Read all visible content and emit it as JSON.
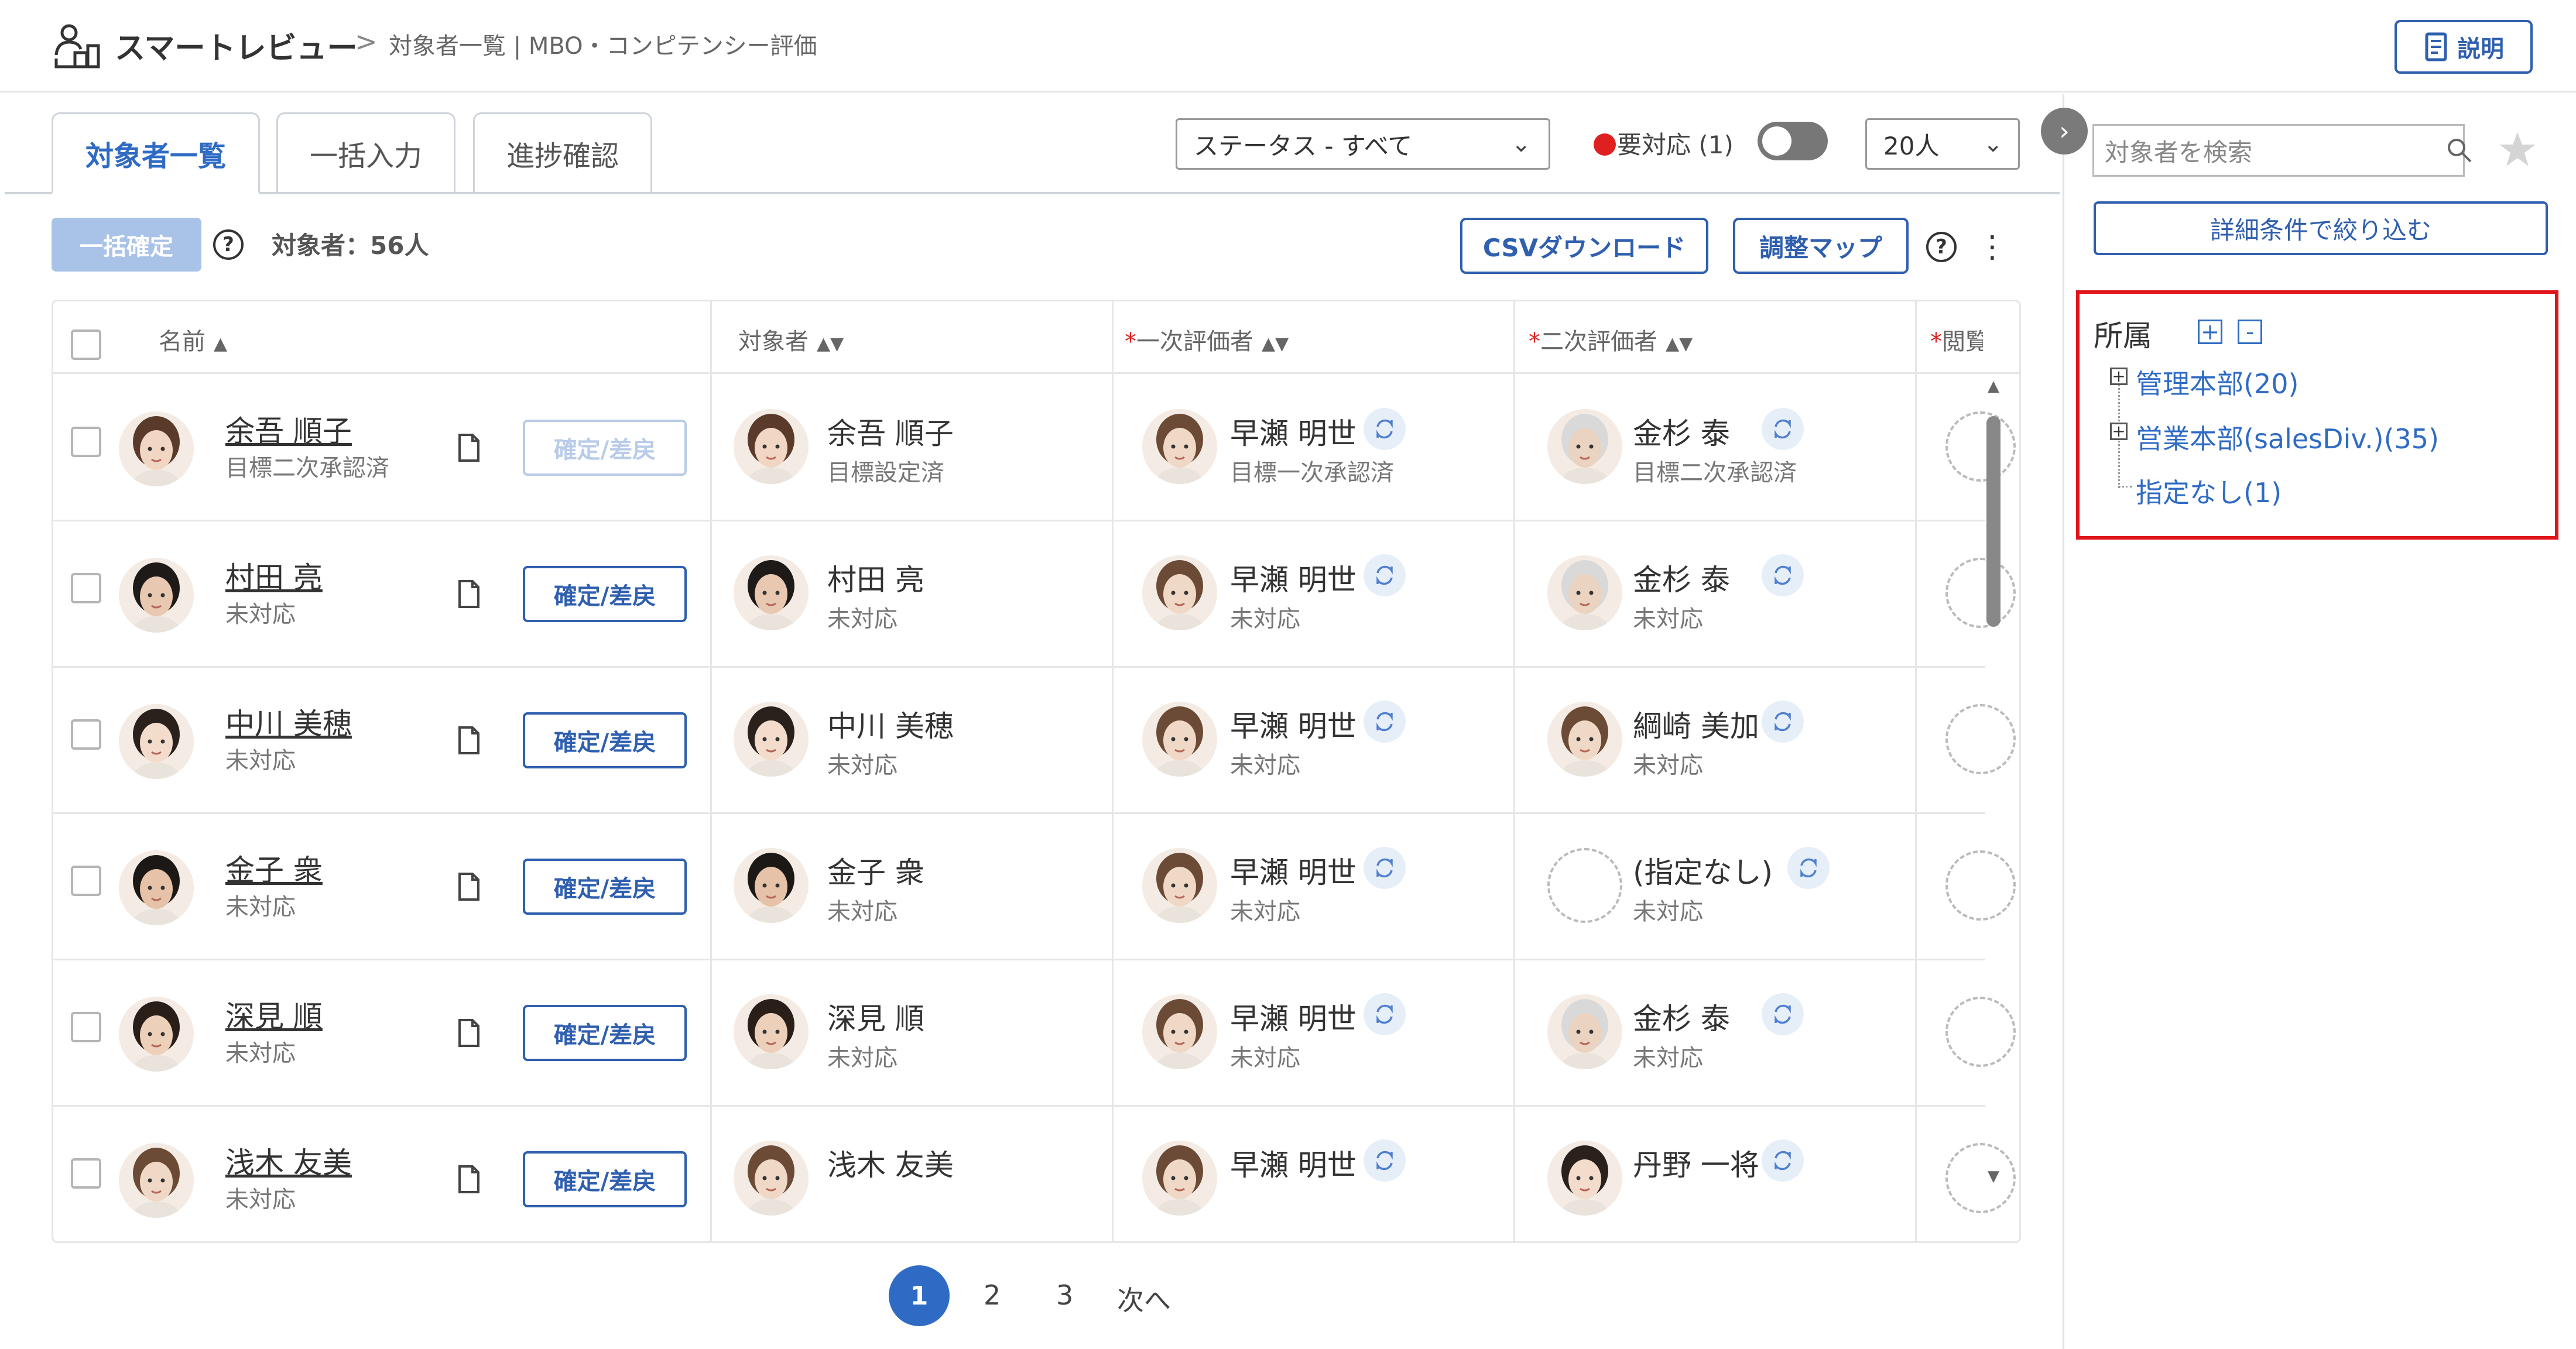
{
  "header": {
    "app_title": "スマートレビュー",
    "breadcrumb_sep": ">",
    "breadcrumb_current": "対象者一覧 | MBO・コンピテンシー評価",
    "help_label": "説明"
  },
  "tabs": [
    {
      "label": "対象者一覧",
      "active": true
    },
    {
      "label": "一括入力",
      "active": false
    },
    {
      "label": "進捗確認",
      "active": false
    }
  ],
  "filters": {
    "status_value": "ステータス - すべて",
    "attention_label": "要対応 (1)",
    "attention_toggle_on": false,
    "per_page_value": "20人"
  },
  "toolbar": {
    "bulk_confirm_label": "一括確定",
    "count_label": "対象者：56人",
    "csv_label": "CSVダウンロード",
    "map_label": "調整マップ"
  },
  "table": {
    "columns": [
      {
        "label": "名前",
        "required": false,
        "sort": "▲"
      },
      {
        "label": "対象者",
        "required": false,
        "sort": "▲▼"
      },
      {
        "label": "一次評価者",
        "required": true,
        "sort": "▲▼"
      },
      {
        "label": "二次評価者",
        "required": true,
        "sort": "▲▼"
      },
      {
        "label": "閲覧者",
        "required": true,
        "sort": ""
      }
    ],
    "rows": [
      {
        "name": "余吾 順子",
        "name_status": "目標二次承認済",
        "confirm_label": "確定/差戻",
        "confirm_disabled": true,
        "target": "余吾 順子",
        "target_status": "目標設定済",
        "first": "早瀬 明世",
        "first_status": "目標一次承認済",
        "second": "金杉 泰",
        "second_status": "目標二次承認済",
        "second_empty": false
      },
      {
        "name": "村田 亮",
        "name_status": "未対応",
        "confirm_label": "確定/差戻",
        "confirm_disabled": false,
        "target": "村田 亮",
        "target_status": "未対応",
        "first": "早瀬 明世",
        "first_status": "未対応",
        "second": "金杉 泰",
        "second_status": "未対応",
        "second_empty": false
      },
      {
        "name": "中川 美穂",
        "name_status": "未対応",
        "confirm_label": "確定/差戻",
        "confirm_disabled": false,
        "target": "中川 美穂",
        "target_status": "未対応",
        "first": "早瀬 明世",
        "first_status": "未対応",
        "second": "綱崎 美加",
        "second_status": "未対応",
        "second_empty": false
      },
      {
        "name": "金子 衆",
        "name_status": "未対応",
        "confirm_label": "確定/差戻",
        "confirm_disabled": false,
        "target": "金子 衆",
        "target_status": "未対応",
        "first": "早瀬 明世",
        "first_status": "未対応",
        "second": "(指定なし)",
        "second_status": "未対応",
        "second_empty": true
      },
      {
        "name": "深見 順",
        "name_status": "未対応",
        "confirm_label": "確定/差戻",
        "confirm_disabled": false,
        "target": "深見 順",
        "target_status": "未対応",
        "first": "早瀬 明世",
        "first_status": "未対応",
        "second": "金杉 泰",
        "second_status": "未対応",
        "second_empty": false
      },
      {
        "name": "浅木 友美",
        "name_status": "未対応",
        "confirm_label": "確定/差戻",
        "confirm_disabled": false,
        "target": "浅木 友美",
        "target_status": "",
        "first": "早瀬 明世",
        "first_status": "",
        "second": "丹野 一将",
        "second_status": "",
        "second_empty": false
      }
    ]
  },
  "pagination": {
    "current": "1",
    "pages": [
      "2",
      "3"
    ],
    "next_label": "次へ"
  },
  "side": {
    "search_placeholder": "対象者を検索",
    "filter_label": "詳細条件で絞り込む",
    "dept_title": "所属",
    "expand_all": "+",
    "collapse_all": "-",
    "tree": [
      {
        "label": "管理本部(20)",
        "expandable": true
      },
      {
        "label": "営業本部(salesDiv.)(35)",
        "expandable": true
      },
      {
        "label": "指定なし(1)",
        "expandable": false
      }
    ]
  },
  "colors": {
    "accent": "#2f6bc4",
    "button_border": "#2f5fae",
    "required": "#e02020",
    "highlight_box": "#e0151a"
  }
}
